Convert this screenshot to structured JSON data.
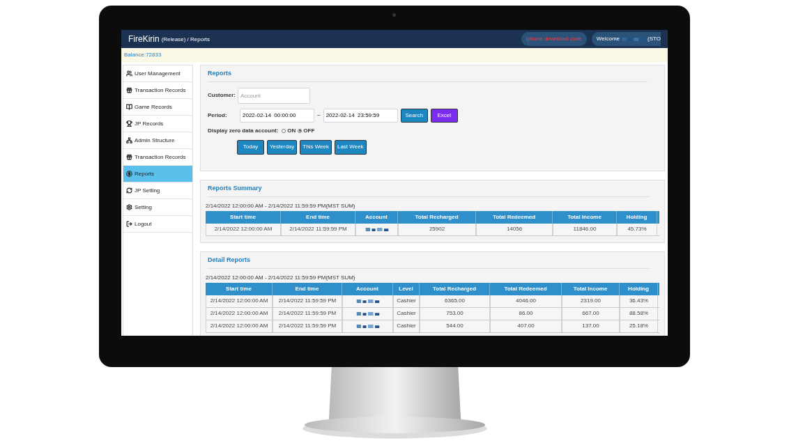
{
  "header": {
    "brand": "FireKirin",
    "subtitle": "(Release) / Reports",
    "download": "iphone download code",
    "welcome": "Welcome",
    "welcome_tail": "(STO"
  },
  "balance": "Balance:72833",
  "sidebar": {
    "items": [
      {
        "label": "User Management",
        "selected": false
      },
      {
        "label": "Transaction Records",
        "selected": false
      },
      {
        "label": "Game Records",
        "selected": false
      },
      {
        "label": "JP Records",
        "selected": false
      },
      {
        "label": "Admin Structure",
        "selected": false
      },
      {
        "label": "Transaction Records",
        "selected": false
      },
      {
        "label": "Reports",
        "selected": true
      },
      {
        "label": "JP Setting",
        "selected": false
      },
      {
        "label": "Setting",
        "selected": false
      },
      {
        "label": "Logout",
        "selected": false
      }
    ]
  },
  "reports": {
    "title": "Reports",
    "customer_label": "Customer:",
    "customer_placeholder": "Account",
    "period_label": "Period:",
    "period_start": "2022-02-14  00:00:00",
    "period_sep": "~",
    "period_end": "2022-02-14  23:59:59",
    "search": "Search",
    "excel": "Excel",
    "zero_label": "Display zero data account:",
    "zero_options": [
      {
        "label": "ON",
        "selected": false
      },
      {
        "label": "OFF",
        "selected": true
      }
    ],
    "quick": [
      "Today",
      "Yesterday",
      "This Week",
      "Last Week"
    ]
  },
  "summary": {
    "title": "Reports Summary",
    "range": "2/14/2022 12:00:00 AM - 2/14/2022 11:59:59 PM(MST SUM)",
    "columns": [
      "Start time",
      "End time",
      "Account",
      "Total Recharged",
      "Total Redeemed",
      "Total Income",
      "Holding"
    ],
    "rows": [
      [
        "2/14/2022 12:00:00 AM",
        "2/14/2022 11:59:59 PM",
        "",
        "25902",
        "14056",
        "11846.00",
        "45.73%"
      ]
    ]
  },
  "detail": {
    "title": "Detail Reports",
    "range": "2/14/2022 12:00:00 AM - 2/14/2022 11:59:59 PM(MST SUM)",
    "columns": [
      "Start time",
      "End time",
      "Account",
      "Level",
      "Total Recharged",
      "Total Redeemed",
      "Total Income",
      "Holding"
    ],
    "rows": [
      [
        "2/14/2022 12:00:00 AM",
        "2/14/2022 11:59:59 PM",
        "",
        "Cashier",
        "6365.00",
        "4046.00",
        "2319.00",
        "36.43%"
      ],
      [
        "2/14/2022 12:00:00 AM",
        "2/14/2022 11:59:59 PM",
        "",
        "Cashier",
        "753.00",
        "86.00",
        "667.00",
        "88.58%"
      ],
      [
        "2/14/2022 12:00:00 AM",
        "2/14/2022 11:59:59 PM",
        "",
        "Cashier",
        "544.00",
        "407.00",
        "137.00",
        "25.18%"
      ]
    ]
  }
}
